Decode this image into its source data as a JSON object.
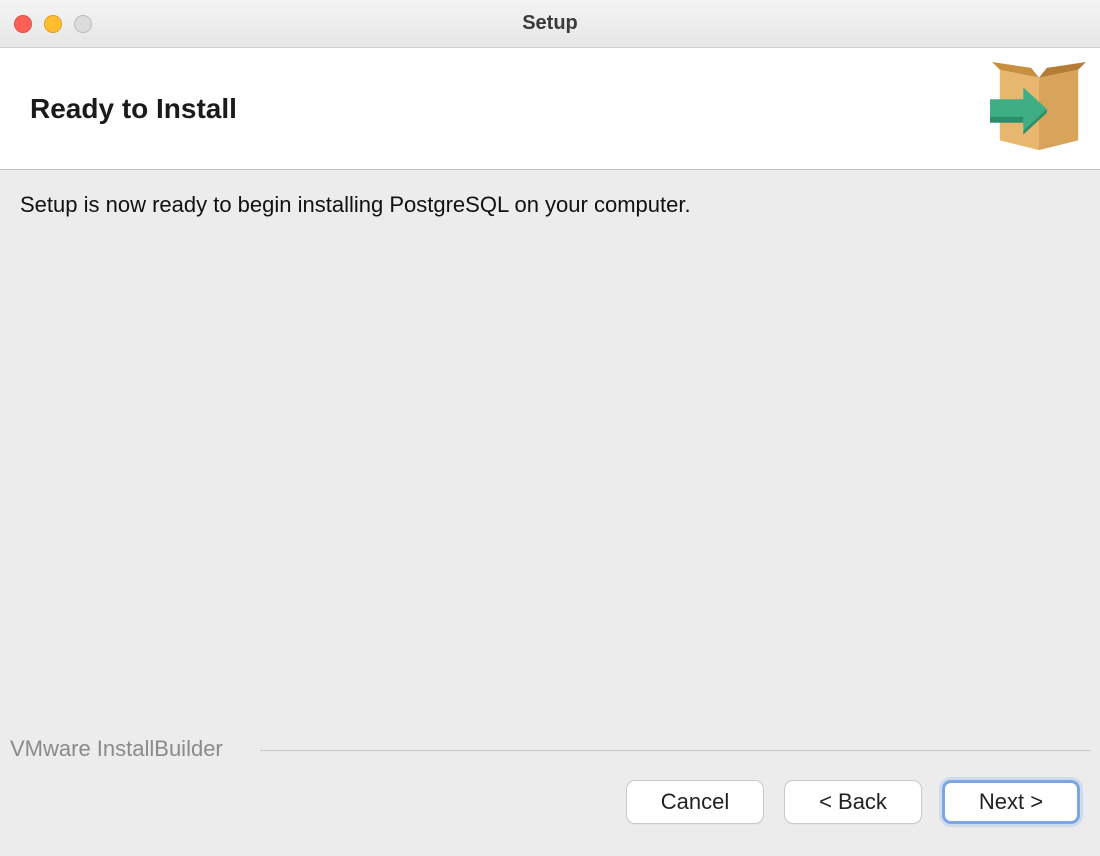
{
  "window": {
    "title": "Setup"
  },
  "header": {
    "heading": "Ready to Install"
  },
  "content": {
    "message": "Setup is now ready to begin installing PostgreSQL on your computer."
  },
  "footer": {
    "brand": "VMware InstallBuilder",
    "buttons": {
      "cancel": "Cancel",
      "back": "< Back",
      "next": "Next >"
    }
  }
}
